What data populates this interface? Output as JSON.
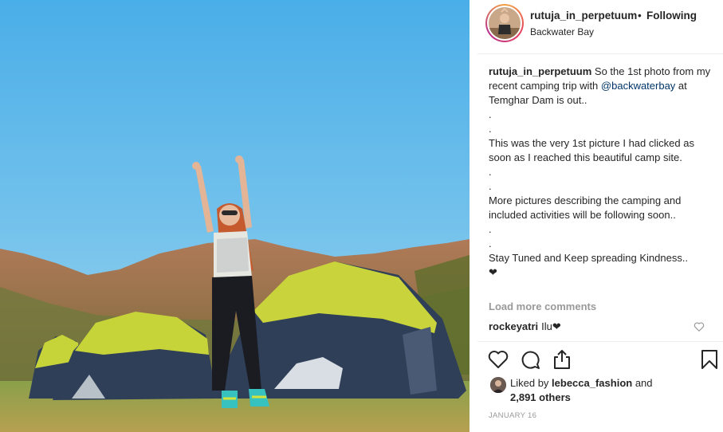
{
  "post": {
    "username": "rutuja_in_perpetuum",
    "separator": "•",
    "follow_status": "Following",
    "location": "Backwater Bay"
  },
  "caption": {
    "username": "rutuja_in_perpetuum",
    "line1_text": " So the 1st photo from my recent camping trip with ",
    "mention": "@backwaterbay",
    "line1_tail": " at Temghar Dam is out..",
    "dot1": ".",
    "dot2": ".",
    "para2": "This was the very 1st picture I had clicked as soon as I reached this beautiful camp site.",
    "dot3": ".",
    "dot4": ".",
    "para3": "More pictures describing the camping and included activities will be following soon..",
    "dot5": ".",
    "dot6": ".",
    "para4": "Stay Tuned and Keep spreading Kindness..",
    "heart": "❤"
  },
  "comments": {
    "load_more": "Load more comments",
    "items": [
      {
        "username": "rockeyatri",
        "text": "Ilu❤"
      }
    ]
  },
  "actions": {
    "like_icon": "heart-icon",
    "comment_icon": "comment-icon",
    "share_icon": "share-icon",
    "save_icon": "bookmark-icon"
  },
  "likes": {
    "prefix": "Liked by ",
    "user": "lebecca_fashion",
    "middle": " and",
    "count": "2,891 others"
  },
  "date": "JANUARY 16",
  "colors": {
    "link": "#003569",
    "muted": "#999999",
    "text": "#262626",
    "sky": "#5cb8ec",
    "tent_lime": "#c6d43a",
    "tent_navy": "#2f3f58"
  }
}
